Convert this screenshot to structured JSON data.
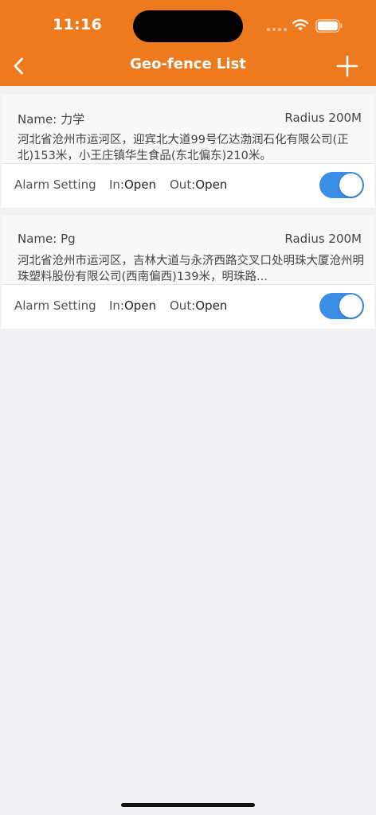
{
  "status_bar": {
    "time": "11:16"
  },
  "nav": {
    "title": "Geo-fence List"
  },
  "colors": {
    "header": "#ee7a1f",
    "toggle_on": "#3a8ee6"
  },
  "fences": [
    {
      "name": "Name: 力学",
      "radius": "Radius 200M",
      "address": "河北省沧州市运河区，迎宾北大道99号亿达渤润石化有限公司(正北)153米，小王庄镇华生食品(东北偏东)210米。",
      "alarm_label": "Alarm Setting",
      "in_label": "In:",
      "in_value": "Open",
      "out_label": "Out:",
      "out_value": "Open",
      "enabled": true
    },
    {
      "name": "Name: Pg",
      "radius": "Radius 200M",
      "address": "河北省沧州市运河区，吉林大道与永济西路交叉口处明珠大厦沧州明珠塑料股份有限公司(西南偏西)139米，明珠路...",
      "alarm_label": "Alarm Setting",
      "in_label": "In:",
      "in_value": "Open",
      "out_label": "Out:",
      "out_value": "Open",
      "enabled": true
    }
  ]
}
